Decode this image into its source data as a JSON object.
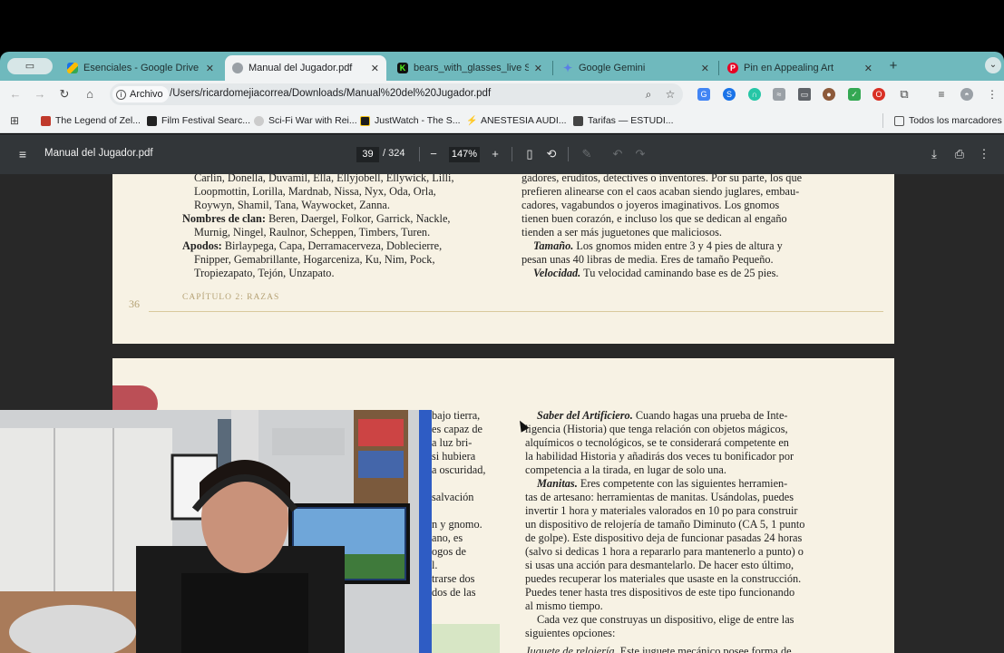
{
  "tabs": [
    {
      "title": "Esenciales - Google Drive",
      "icon": "google-drive-icon"
    },
    {
      "title": "Manual del Jugador.pdf",
      "icon": "globe-icon"
    },
    {
      "title": "bears_with_glasses_live Stre",
      "icon": "kick-icon"
    },
    {
      "title": "Google Gemini",
      "icon": "gemini-icon"
    },
    {
      "title": "Pin en Appealing Art",
      "icon": "pinterest-icon"
    }
  ],
  "omnibox": {
    "chip": "Archivo",
    "url": "/Users/ricardomejiacorrea/Downloads/Manual%20del%20Jugador.pdf"
  },
  "bookmarks": [
    {
      "label": "The Legend of Zel..."
    },
    {
      "label": "Film Festival Searc..."
    },
    {
      "label": "Sci-Fi War with Rei..."
    },
    {
      "label": "JustWatch - The S..."
    },
    {
      "label": "ANESTESIA AUDI..."
    },
    {
      "label": "Tarifas — ESTUDI..."
    }
  ],
  "all_bookmarks": "Todos los marcadores",
  "pdf": {
    "title": "Manual del Jugador.pdf",
    "page": "39",
    "total": "/ 324",
    "zoom": "147%"
  },
  "page36": {
    "left": [
      "Carlin, Donella, Duvamil, Ella, Ellyjobell, Ellywick, Lilli,",
      "Loopmottin, Lorilla, Mardnab, Nissa, Nyx, Oda, Orla,",
      "Roywyn, Shamil, Tana, Waywocket, Zanna."
    ],
    "clan_label": "Nombres de clan:",
    "clan_text": "Beren, Daergel, Folkor, Garrick, Nackle,",
    "clan_cont": "Murnig, Ningel, Raulnor, Scheppen, Timbers, Turen.",
    "apodos_label": "Apodos:",
    "apodos_text": "Birlaypega, Capa, Derramacerveza, Doblecierre,",
    "apodos_cont": [
      "Fnipper, Gemabrillante, Hogarceniza, Ku, Nim, Pock,",
      "Tropiezapato, Tejón, Unzapato."
    ],
    "right": [
      "gadores, eruditos, detectives o inventores. Por su parte, los que",
      "prefieren alinearse con el caos acaban siendo juglares, embau-",
      "cadores, vagabundos o joyeros imaginativos. Los gnomos",
      "tienen buen corazón, e incluso los que se dedican al engaño",
      "tienden a ser más juguetones que maliciosos."
    ],
    "tamano_label": "Tamaño.",
    "tamano_text": "Los gnomos miden entre 3 y 4 pies de altura y",
    "tamano_cont": "pesan unas 40 libras de media. Eres de tamaño Pequeño.",
    "velocidad_label": "Velocidad.",
    "velocidad_text": "Tu velocidad caminando base es de 25 pies.",
    "page_number": "36",
    "chapter": "CAPÍTULO 2: RAZAS"
  },
  "page37": {
    "left_fragments": [
      "bajo tierra,",
      "es capaz de",
      "a luz bri-",
      "si hubiera",
      "a oscuridad,",
      "salvación",
      "n y gnomo.",
      "ano, es",
      "ogos de",
      "l.",
      "trarse dos",
      "dos de las"
    ],
    "saber_label": "Saber del Artificiero.",
    "saber_text": "Cuando hagas una prueba de Inte-",
    "saber_cont": [
      "ligencia (Historia) que tenga relación con objetos mágicos,",
      "alquímicos o tecnológicos, se te considerará competente en",
      "la habilidad Historia y añadirás dos veces tu bonificador por",
      "competencia a la tirada, en lugar de solo una."
    ],
    "manitas_label": "Manitas.",
    "manitas_text": "Eres competente con las siguientes herramien-",
    "manitas_cont": [
      "tas de artesano: herramientas de manitas. Usándolas, puedes",
      "invertir 1 hora y materiales valorados en 10 po para construir",
      "un dispositivo de relojería de tamaño Diminuto (CA 5, 1 punto",
      "de golpe). Este dispositivo deja de funcionar pasadas 24 horas",
      "(salvo si dedicas 1 hora a repararlo para mantenerlo a punto) o",
      "si usas una acción para desmantelarlo. De hacer esto último,",
      "puedes recuperar los materiales que usaste en la construcción.",
      "Puedes tener hasta tres dispositivos de este tipo funcionando",
      "al mismo tiempo."
    ],
    "cada_vez": "Cada vez que construyas un dispositivo, elige de entre las",
    "cada_vez_cont": "siguientes opciones:",
    "juguete_label": "Juguete de relojería.",
    "juguete_text": "Este juguete mecánico posee forma de"
  }
}
